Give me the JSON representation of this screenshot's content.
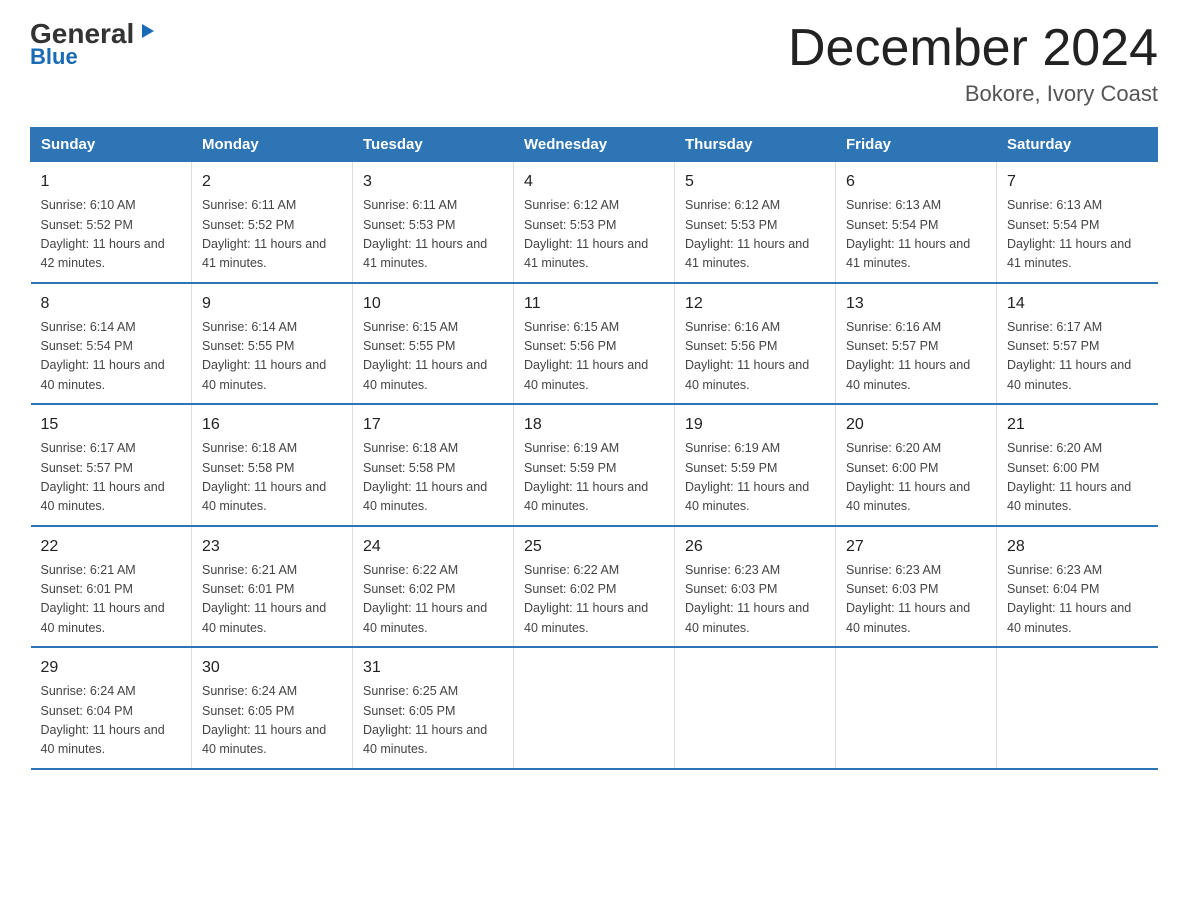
{
  "logo": {
    "general": "General",
    "blue": "Blue",
    "arrow": "▶"
  },
  "header": {
    "month_title": "December 2024",
    "location": "Bokore, Ivory Coast"
  },
  "weekdays": [
    "Sunday",
    "Monday",
    "Tuesday",
    "Wednesday",
    "Thursday",
    "Friday",
    "Saturday"
  ],
  "weeks": [
    [
      {
        "day": "1",
        "sunrise": "6:10 AM",
        "sunset": "5:52 PM",
        "daylight": "11 hours and 42 minutes."
      },
      {
        "day": "2",
        "sunrise": "6:11 AM",
        "sunset": "5:52 PM",
        "daylight": "11 hours and 41 minutes."
      },
      {
        "day": "3",
        "sunrise": "6:11 AM",
        "sunset": "5:53 PM",
        "daylight": "11 hours and 41 minutes."
      },
      {
        "day": "4",
        "sunrise": "6:12 AM",
        "sunset": "5:53 PM",
        "daylight": "11 hours and 41 minutes."
      },
      {
        "day": "5",
        "sunrise": "6:12 AM",
        "sunset": "5:53 PM",
        "daylight": "11 hours and 41 minutes."
      },
      {
        "day": "6",
        "sunrise": "6:13 AM",
        "sunset": "5:54 PM",
        "daylight": "11 hours and 41 minutes."
      },
      {
        "day": "7",
        "sunrise": "6:13 AM",
        "sunset": "5:54 PM",
        "daylight": "11 hours and 41 minutes."
      }
    ],
    [
      {
        "day": "8",
        "sunrise": "6:14 AM",
        "sunset": "5:54 PM",
        "daylight": "11 hours and 40 minutes."
      },
      {
        "day": "9",
        "sunrise": "6:14 AM",
        "sunset": "5:55 PM",
        "daylight": "11 hours and 40 minutes."
      },
      {
        "day": "10",
        "sunrise": "6:15 AM",
        "sunset": "5:55 PM",
        "daylight": "11 hours and 40 minutes."
      },
      {
        "day": "11",
        "sunrise": "6:15 AM",
        "sunset": "5:56 PM",
        "daylight": "11 hours and 40 minutes."
      },
      {
        "day": "12",
        "sunrise": "6:16 AM",
        "sunset": "5:56 PM",
        "daylight": "11 hours and 40 minutes."
      },
      {
        "day": "13",
        "sunrise": "6:16 AM",
        "sunset": "5:57 PM",
        "daylight": "11 hours and 40 minutes."
      },
      {
        "day": "14",
        "sunrise": "6:17 AM",
        "sunset": "5:57 PM",
        "daylight": "11 hours and 40 minutes."
      }
    ],
    [
      {
        "day": "15",
        "sunrise": "6:17 AM",
        "sunset": "5:57 PM",
        "daylight": "11 hours and 40 minutes."
      },
      {
        "day": "16",
        "sunrise": "6:18 AM",
        "sunset": "5:58 PM",
        "daylight": "11 hours and 40 minutes."
      },
      {
        "day": "17",
        "sunrise": "6:18 AM",
        "sunset": "5:58 PM",
        "daylight": "11 hours and 40 minutes."
      },
      {
        "day": "18",
        "sunrise": "6:19 AM",
        "sunset": "5:59 PM",
        "daylight": "11 hours and 40 minutes."
      },
      {
        "day": "19",
        "sunrise": "6:19 AM",
        "sunset": "5:59 PM",
        "daylight": "11 hours and 40 minutes."
      },
      {
        "day": "20",
        "sunrise": "6:20 AM",
        "sunset": "6:00 PM",
        "daylight": "11 hours and 40 minutes."
      },
      {
        "day": "21",
        "sunrise": "6:20 AM",
        "sunset": "6:00 PM",
        "daylight": "11 hours and 40 minutes."
      }
    ],
    [
      {
        "day": "22",
        "sunrise": "6:21 AM",
        "sunset": "6:01 PM",
        "daylight": "11 hours and 40 minutes."
      },
      {
        "day": "23",
        "sunrise": "6:21 AM",
        "sunset": "6:01 PM",
        "daylight": "11 hours and 40 minutes."
      },
      {
        "day": "24",
        "sunrise": "6:22 AM",
        "sunset": "6:02 PM",
        "daylight": "11 hours and 40 minutes."
      },
      {
        "day": "25",
        "sunrise": "6:22 AM",
        "sunset": "6:02 PM",
        "daylight": "11 hours and 40 minutes."
      },
      {
        "day": "26",
        "sunrise": "6:23 AM",
        "sunset": "6:03 PM",
        "daylight": "11 hours and 40 minutes."
      },
      {
        "day": "27",
        "sunrise": "6:23 AM",
        "sunset": "6:03 PM",
        "daylight": "11 hours and 40 minutes."
      },
      {
        "day": "28",
        "sunrise": "6:23 AM",
        "sunset": "6:04 PM",
        "daylight": "11 hours and 40 minutes."
      }
    ],
    [
      {
        "day": "29",
        "sunrise": "6:24 AM",
        "sunset": "6:04 PM",
        "daylight": "11 hours and 40 minutes."
      },
      {
        "day": "30",
        "sunrise": "6:24 AM",
        "sunset": "6:05 PM",
        "daylight": "11 hours and 40 minutes."
      },
      {
        "day": "31",
        "sunrise": "6:25 AM",
        "sunset": "6:05 PM",
        "daylight": "11 hours and 40 minutes."
      },
      null,
      null,
      null,
      null
    ]
  ]
}
